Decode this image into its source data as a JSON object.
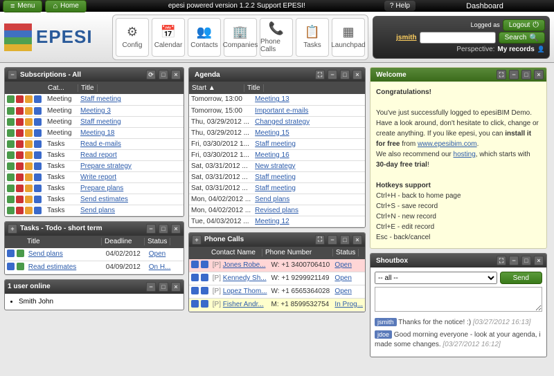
{
  "top": {
    "menu": "Menu",
    "home": "Home",
    "center": "epesi powered  version 1.2.2   Support EPESI!",
    "help": "Help",
    "dashboard": "Dashboard"
  },
  "user": {
    "logged_as": "Logged as",
    "name": "jsmith",
    "logout": "Logout",
    "search": "Search",
    "perspective": "Perspective:",
    "my_records": "My records"
  },
  "tools": [
    {
      "k": "config",
      "l": "Config"
    },
    {
      "k": "calendar",
      "l": "Calendar"
    },
    {
      "k": "contacts",
      "l": "Contacts"
    },
    {
      "k": "companies",
      "l": "Companies"
    },
    {
      "k": "phone",
      "l": "Phone Calls"
    },
    {
      "k": "tasks",
      "l": "Tasks"
    },
    {
      "k": "launchpad",
      "l": "Launchpad"
    }
  ],
  "subs": {
    "title": "Subscriptions - All",
    "cols": [
      "Cat...",
      "Title"
    ],
    "rows": [
      [
        "Meeting",
        "Staff meeting"
      ],
      [
        "Meeting",
        "Meeting 3"
      ],
      [
        "Meeting",
        "Staff meeting"
      ],
      [
        "Meeting",
        "Meeting 18"
      ],
      [
        "Tasks",
        "Read e-mails"
      ],
      [
        "Tasks",
        "Read report"
      ],
      [
        "Tasks",
        "Prepare strategy"
      ],
      [
        "Tasks",
        "Write report"
      ],
      [
        "Tasks",
        "Prepare plans"
      ],
      [
        "Tasks",
        "Send estimates"
      ],
      [
        "Tasks",
        "Send plans"
      ]
    ]
  },
  "todo": {
    "title": "Tasks - Todo - short term",
    "cols": [
      "Title",
      "Deadline",
      "Status"
    ],
    "rows": [
      [
        "Send plans",
        "04/02/2012",
        "Open"
      ],
      [
        "Read estimates",
        "04/09/2012",
        "On H..."
      ]
    ]
  },
  "users": {
    "title": "1 user online",
    "list": [
      "Smith John"
    ]
  },
  "agenda": {
    "title": "Agenda",
    "cols": [
      "Start ▲",
      "Title"
    ],
    "rows": [
      [
        "Tomorrow, 13:00",
        "Meeting 13"
      ],
      [
        "Tomorrow, 15:00",
        "Important e-mails"
      ],
      [
        "Thu, 03/29/2012 ...",
        "Changed strategy"
      ],
      [
        "Thu, 03/29/2012 ...",
        "Meeting 15"
      ],
      [
        "Fri, 03/30/2012 1...",
        "Staff meeting"
      ],
      [
        "Fri, 03/30/2012 1...",
        "Meeting 16"
      ],
      [
        "Sat, 03/31/2012 ...",
        "New strategy"
      ],
      [
        "Sat, 03/31/2012 ...",
        "Staff meeting"
      ],
      [
        "Sat, 03/31/2012 ...",
        "Staff meeting"
      ],
      [
        "Mon, 04/02/2012 ...",
        "Send plans"
      ],
      [
        "Mon, 04/02/2012 ...",
        "Revised plans"
      ],
      [
        "Tue, 04/03/2012 ...",
        "Meeting 12"
      ]
    ]
  },
  "phone": {
    "title": "Phone Calls",
    "cols": [
      "Contact Name",
      "Phone Number",
      "Status"
    ],
    "rows": [
      {
        "p": "[P]",
        "n": "Jones Robe...",
        "ph": "W: +1 3400706410",
        "s": "Open",
        "cls": "hl-pink"
      },
      {
        "p": "[P]",
        "n": "Kennedy Sh...",
        "ph": "W: +1 9299921149",
        "s": "Open",
        "cls": ""
      },
      {
        "p": "[P]",
        "n": "Lopez Thom...",
        "ph": "W: +1 6565364028",
        "s": "Open",
        "cls": ""
      },
      {
        "p": "[P]",
        "n": "Fisher Andr...",
        "ph": "M: +1 8599532754",
        "s": "In Prog...",
        "cls": "hl-yel"
      }
    ]
  },
  "welcome": {
    "title": "Welcome",
    "heading": "Congratulations!",
    "p1": "You've just successfully logged to epesiBIM Demo. Have a look around, don't hesitate to click, change or create anything. If you like epesi, you can ",
    "install": "install it for free",
    "from": " from ",
    "site": "www.epesibim.com",
    "p2": "We also recommend our ",
    "hosting": "hosting",
    "p2b": ", which starts with ",
    "trial": "30-day free trial",
    "ex": "!",
    "hk": "Hotkeys support",
    "keys": [
      "Ctrl+H - back to home page",
      "Ctrl+S - save record",
      "Ctrl+N - new record",
      "Ctrl+E - edit record",
      "Esc - back/cancel"
    ]
  },
  "shout": {
    "title": "Shoutbox",
    "all": "-- all --",
    "send": "Send",
    "msgs": [
      {
        "u": "jsmith",
        "t": "Thanks for the notice! :)",
        "ts": "[03/27/2012 16:13]"
      },
      {
        "u": "jdoe",
        "t": "Good morning everyone - look at your agenda, i made some changes.",
        "ts": "[03/27/2012 16:12]"
      }
    ]
  }
}
